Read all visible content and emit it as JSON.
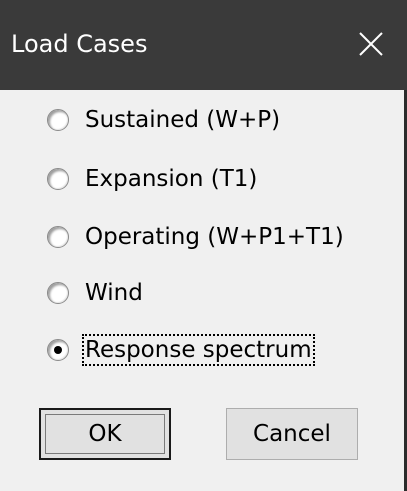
{
  "window": {
    "title": "Load Cases"
  },
  "options": [
    {
      "label": "Sustained (W+P)",
      "selected": false
    },
    {
      "label": "Expansion (T1)",
      "selected": false
    },
    {
      "label": "Operating (W+P1+T1)",
      "selected": false
    },
    {
      "label": "Wind",
      "selected": false
    },
    {
      "label": "Response spectrum",
      "selected": true
    }
  ],
  "buttons": {
    "ok": "OK",
    "cancel": "Cancel"
  },
  "icons": {
    "close": "close-icon",
    "radio": "radio-button"
  }
}
